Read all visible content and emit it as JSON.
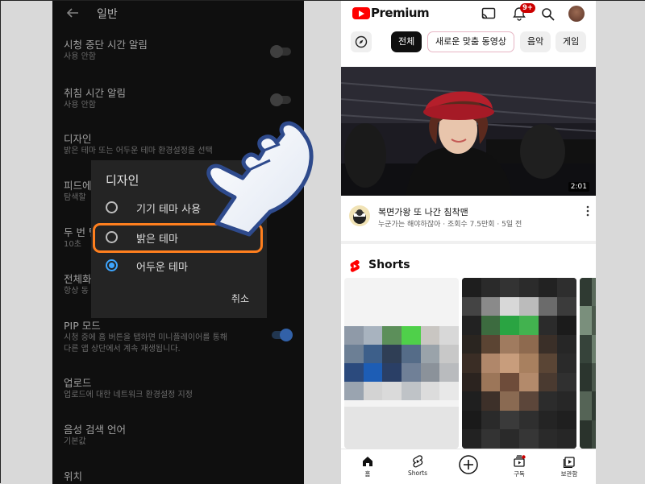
{
  "settings": {
    "title": "일반",
    "rows": [
      {
        "title": "시청 중단 시간 알림",
        "sub": "사용 안함",
        "toggle": "off"
      },
      {
        "title": "취침 시간 알림",
        "sub": "사용 안함",
        "toggle": "off"
      },
      {
        "title": "디자인",
        "sub": "밝은 테마 또는 어두운 테마 환경설정을 선택"
      },
      {
        "title": "피드에",
        "sub": "탐색할"
      },
      {
        "title": "두 번 탭",
        "sub": "10초"
      },
      {
        "title": "전체화",
        "sub": "항상 동"
      },
      {
        "title": "PIP 모드",
        "sub": "시청 중에 홈 버튼을 탭하면 미니플레이어를 통해",
        "sub2": "다른 앱 상단에서 계속 재생됩니다.",
        "toggle": "on"
      },
      {
        "title": "업로드",
        "sub": "업로드에 대한 네트워크 환경설정 지정"
      },
      {
        "title": "음성 검색 언어",
        "sub": "기본값"
      },
      {
        "title": "위치",
        "sub": ""
      }
    ],
    "dialog": {
      "title": "디자인",
      "options": [
        {
          "label": "기기 테마 사용",
          "checked": false
        },
        {
          "label": "밝은 테마",
          "checked": false
        },
        {
          "label": "어두운 테마",
          "checked": true
        }
      ],
      "cancel": "취소"
    }
  },
  "youtube": {
    "brand": "Premium",
    "notification_badge": "9+",
    "chips": [
      "전체",
      "새로운 맞춤 동영상",
      "음악",
      "게임"
    ],
    "video": {
      "duration": "2:01",
      "title": "복면가왕 또 나간 침착맨",
      "subtitle": "누군가는 해야하잖아 · 조회수 7.5만회 · 5일 전"
    },
    "shorts_title": "Shorts",
    "nav": [
      "홈",
      "Shorts",
      "",
      "구독",
      "보관함"
    ]
  },
  "colors": {
    "highlight": "#ff7f1e",
    "accent": "#3ea6ff",
    "youtube_red": "#ff0000"
  }
}
